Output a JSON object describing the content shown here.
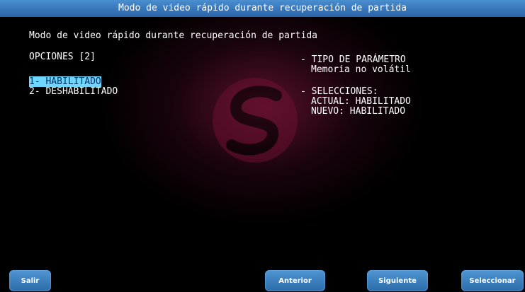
{
  "window": {
    "title": "Modo de video rápido durante recuperación de partida"
  },
  "main": {
    "heading": "Modo de video rápido durante recuperación de partida",
    "options_label": "OPCIONES [2]",
    "options": [
      "1- HABILITADO",
      "2- DESHABILITADO"
    ],
    "param_type_label": "- TIPO DE PARÁMETRO",
    "param_type_value": "Memoria no volátil",
    "selections_label": "- SELECCIONES:",
    "current": "ACTUAL: HABILITADO",
    "new": "NUEVO: HABILITADO"
  },
  "buttons": {
    "exit": "Salir",
    "previous": "Anterior",
    "next": "Siguiente",
    "select": "Seleccionar"
  },
  "colors": {
    "accent": "#3a7cc0",
    "selection": "#6fd7ff",
    "background": "#000000"
  },
  "icons": {
    "logo": "brand-s-logo"
  }
}
